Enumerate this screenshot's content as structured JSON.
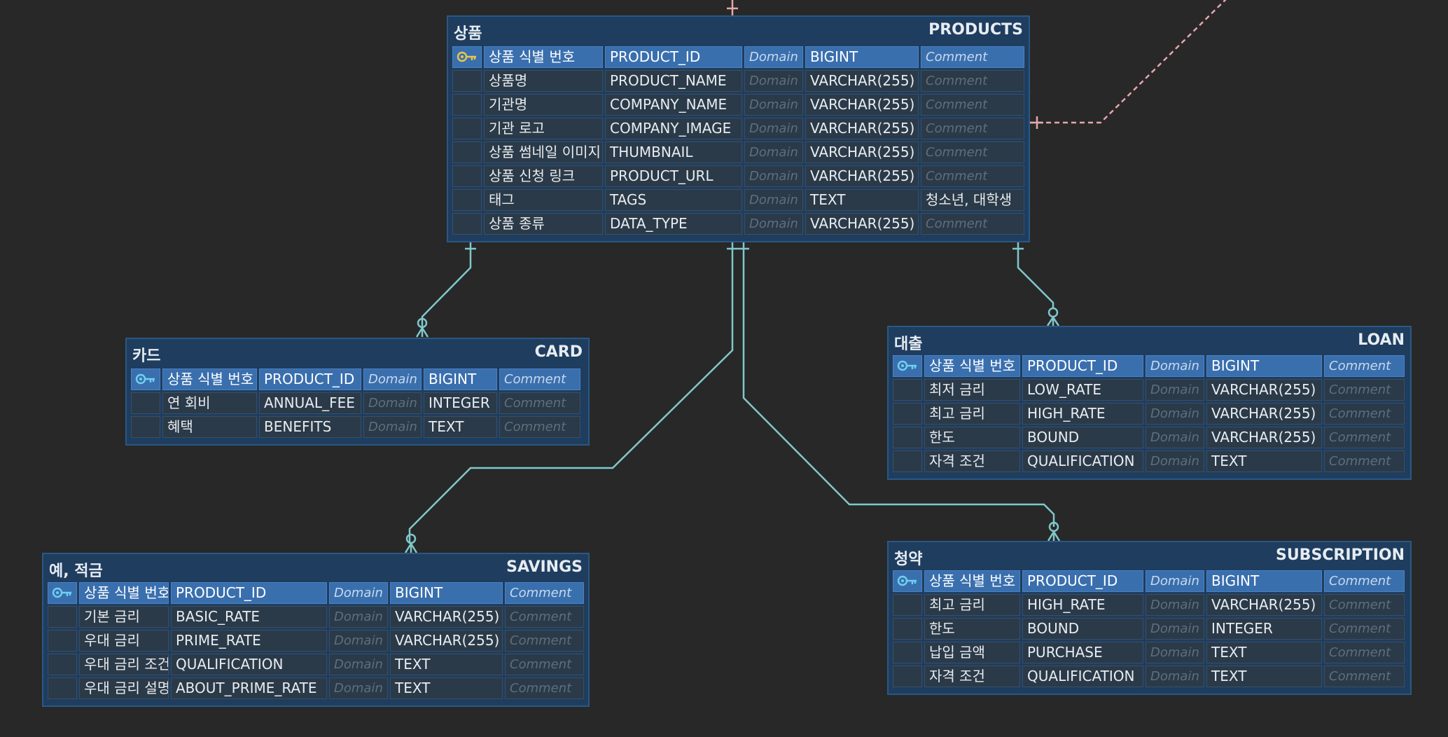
{
  "colors": {
    "background": "#282828",
    "entity_fill": "#1f3d5e",
    "pk_row": "#3a6fae",
    "row_fill": "#2b3a48",
    "connector": "#7fc8cc",
    "external_link": "#e8a6ac"
  },
  "entities": {
    "products": {
      "logical": "상품",
      "physical": "PRODUCTS",
      "rows": [
        {
          "logical": "상품 식별 번호",
          "physical": "PRODUCT_ID",
          "domain": "Domain",
          "type": "BIGINT",
          "comment": "Comment"
        },
        {
          "logical": "상품명",
          "physical": "PRODUCT_NAME",
          "domain": "Domain",
          "type": "VARCHAR(255)",
          "comment": "Comment"
        },
        {
          "logical": "기관명",
          "physical": "COMPANY_NAME",
          "domain": "Domain",
          "type": "VARCHAR(255)",
          "comment": "Comment"
        },
        {
          "logical": "기관 로고",
          "physical": "COMPANY_IMAGE",
          "domain": "Domain",
          "type": "VARCHAR(255)",
          "comment": "Comment"
        },
        {
          "logical": "상품 썸네일 이미지",
          "physical": "THUMBNAIL",
          "domain": "Domain",
          "type": "VARCHAR(255)",
          "comment": "Comment"
        },
        {
          "logical": "상품 신청 링크",
          "physical": "PRODUCT_URL",
          "domain": "Domain",
          "type": "VARCHAR(255)",
          "comment": "Comment"
        },
        {
          "logical": "태그",
          "physical": "TAGS",
          "domain": "Domain",
          "type": "TEXT",
          "comment": "청소년, 대학생"
        },
        {
          "logical": "상품 종류",
          "physical": "DATA_TYPE",
          "domain": "Domain",
          "type": "VARCHAR(255)",
          "comment": "Comment"
        }
      ]
    },
    "card": {
      "logical": "카드",
      "physical": "CARD",
      "rows": [
        {
          "logical": "상품 식별 번호",
          "physical": "PRODUCT_ID",
          "domain": "Domain",
          "type": "BIGINT",
          "comment": "Comment"
        },
        {
          "logical": "연 회비",
          "physical": "ANNUAL_FEE",
          "domain": "Domain",
          "type": "INTEGER",
          "comment": "Comment"
        },
        {
          "logical": "혜택",
          "physical": "BENEFITS",
          "domain": "Domain",
          "type": "TEXT",
          "comment": "Comment"
        }
      ]
    },
    "loan": {
      "logical": "대출",
      "physical": "LOAN",
      "rows": [
        {
          "logical": "상품 식별 번호",
          "physical": "PRODUCT_ID",
          "domain": "Domain",
          "type": "BIGINT",
          "comment": "Comment"
        },
        {
          "logical": "최저 금리",
          "physical": "LOW_RATE",
          "domain": "Domain",
          "type": "VARCHAR(255)",
          "comment": "Comment"
        },
        {
          "logical": "최고 금리",
          "physical": "HIGH_RATE",
          "domain": "Domain",
          "type": "VARCHAR(255)",
          "comment": "Comment"
        },
        {
          "logical": "한도",
          "physical": "BOUND",
          "domain": "Domain",
          "type": "VARCHAR(255)",
          "comment": "Comment"
        },
        {
          "logical": "자격 조건",
          "physical": "QUALIFICATION",
          "domain": "Domain",
          "type": "TEXT",
          "comment": "Comment"
        }
      ]
    },
    "savings": {
      "logical": "예, 적금",
      "physical": "SAVINGS",
      "rows": [
        {
          "logical": "상품 식별 번호",
          "physical": "PRODUCT_ID",
          "domain": "Domain",
          "type": "BIGINT",
          "comment": "Comment"
        },
        {
          "logical": "기본 금리",
          "physical": "BASIC_RATE",
          "domain": "Domain",
          "type": "VARCHAR(255)",
          "comment": "Comment"
        },
        {
          "logical": "우대 금리",
          "physical": "PRIME_RATE",
          "domain": "Domain",
          "type": "VARCHAR(255)",
          "comment": "Comment"
        },
        {
          "logical": "우대 금리 조건",
          "physical": "QUALIFICATION",
          "domain": "Domain",
          "type": "TEXT",
          "comment": "Comment"
        },
        {
          "logical": "우대 금리 설명",
          "physical": "ABOUT_PRIME_RATE",
          "domain": "Domain",
          "type": "TEXT",
          "comment": "Comment"
        }
      ]
    },
    "subscription": {
      "logical": "청약",
      "physical": "SUBSCRIPTION",
      "rows": [
        {
          "logical": "상품 식별 번호",
          "physical": "PRODUCT_ID",
          "domain": "Domain",
          "type": "BIGINT",
          "comment": "Comment"
        },
        {
          "logical": "최고 금리",
          "physical": "HIGH_RATE",
          "domain": "Domain",
          "type": "VARCHAR(255)",
          "comment": "Comment"
        },
        {
          "logical": "한도",
          "physical": "BOUND",
          "domain": "Domain",
          "type": "INTEGER",
          "comment": "Comment"
        },
        {
          "logical": "납입 금액",
          "physical": "PURCHASE",
          "domain": "Domain",
          "type": "TEXT",
          "comment": "Comment"
        },
        {
          "logical": "자격 조건",
          "physical": "QUALIFICATION",
          "domain": "Domain",
          "type": "TEXT",
          "comment": "Comment"
        }
      ]
    }
  }
}
